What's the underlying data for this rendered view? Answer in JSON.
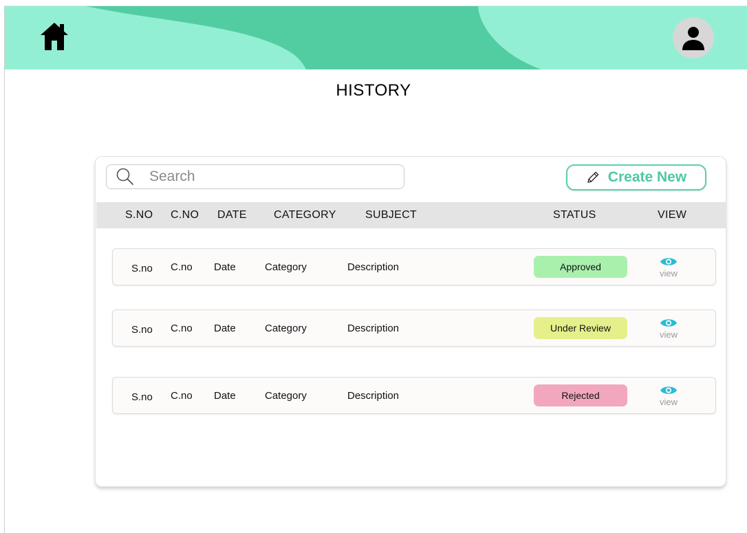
{
  "page": {
    "title": "HISTORY"
  },
  "search": {
    "placeholder": "Search"
  },
  "actions": {
    "create_new": "Create New"
  },
  "table": {
    "headers": [
      "S.NO",
      "C.NO",
      "DATE",
      "CATEGORY",
      "SUBJECT",
      "STATUS",
      "VIEW"
    ],
    "rows": [
      {
        "sno": "S.no",
        "cno": "C.no",
        "date": "Date",
        "category": "Category",
        "subject": "Description",
        "status": "Approved",
        "view": "view"
      },
      {
        "sno": "S.no",
        "cno": "C.no",
        "date": "Date",
        "category": "Category",
        "subject": "Description",
        "status": "Under Review",
        "view": "view"
      },
      {
        "sno": "S.no",
        "cno": "C.no",
        "date": "Date",
        "category": "Category",
        "subject": "Description",
        "status": "Rejected",
        "view": "view"
      }
    ]
  },
  "colors": {
    "header_light": "#93efd4",
    "header_dark": "#52cda2",
    "accent": "#4ec8a4",
    "status_approved": "#a9f0ad",
    "status_under_review": "#e6f08a",
    "status_rejected": "#f2a7be",
    "eye_icon": "#2bbcd3"
  },
  "icons": {
    "home": "home-icon",
    "profile": "user-icon",
    "search": "search-icon",
    "create": "pencil-icon",
    "view": "eye-icon"
  }
}
